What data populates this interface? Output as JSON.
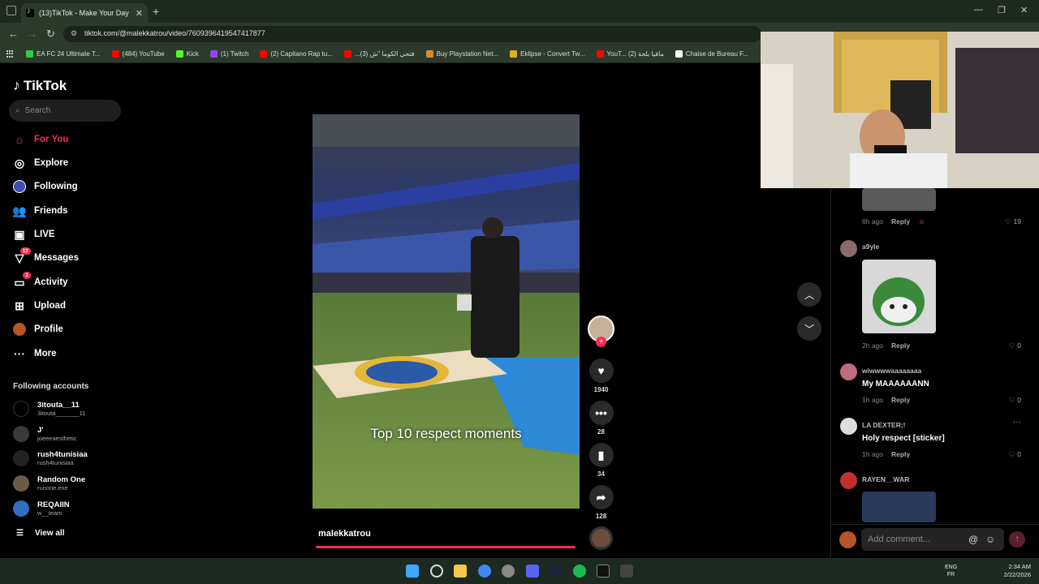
{
  "browser": {
    "tab_title": "(13)TikTok - Make Your Day",
    "new_tab": "+",
    "url": "tiktok.com/@malekkatrou/video/7609396419547417877",
    "bookmarks": [
      {
        "label": "EA FC 24 Ultimate T...",
        "color": "#2ecc40"
      },
      {
        "label": "(484) YouTube",
        "color": "#ff0000"
      },
      {
        "label": "Kick",
        "color": "#53fc18"
      },
      {
        "label": "(1) Twitch",
        "color": "#9146ff"
      },
      {
        "label": "(2) Capitano Rap tu...",
        "color": "#ff0000"
      },
      {
        "label": "...(3) فتحي الكوما \"ش",
        "color": "#ff0000"
      },
      {
        "label": "Buy Playstation Net...",
        "color": "#d98c2b"
      },
      {
        "label": "Eklipse - Convert Tw...",
        "color": "#e0b020"
      },
      {
        "label": "YouT... (2) مافيا بلحة",
        "color": "#ff0000"
      },
      {
        "label": "Chaise de Bureau F...",
        "color": "#ffffff"
      }
    ]
  },
  "sidebar": {
    "logo": "TikTok",
    "search_placeholder": "Search",
    "nav": [
      {
        "label": "For You",
        "icon": "home-icon",
        "active": true
      },
      {
        "label": "Explore",
        "icon": "compass-icon"
      },
      {
        "label": "Following",
        "icon": "following-avatar-icon"
      },
      {
        "label": "Friends",
        "icon": "friends-icon"
      },
      {
        "label": "LIVE",
        "icon": "live-icon"
      },
      {
        "label": "Messages",
        "icon": "messages-icon",
        "badge": "12"
      },
      {
        "label": "Activity",
        "icon": "activity-icon",
        "badge": "1"
      },
      {
        "label": "Upload",
        "icon": "upload-icon"
      },
      {
        "label": "Profile",
        "icon": "profile-icon"
      },
      {
        "label": "More",
        "icon": "more-icon"
      }
    ],
    "following_title": "Following accounts",
    "accounts": [
      {
        "name": "3itouta__11",
        "handle": "3itouta_______11"
      },
      {
        "name": "J'",
        "handle": "joeeeaesthetic"
      },
      {
        "name": "rush4tunisiaa",
        "handle": "rush4tunisiaa"
      },
      {
        "name": "Random One",
        "handle": "runone.exe"
      },
      {
        "name": "REQAIIN",
        "handle": "w__team"
      }
    ],
    "view_all": "View all"
  },
  "video": {
    "caption": "Top 10 respect moments",
    "author": "malekkatrou",
    "likes": "1940",
    "comments": "28",
    "saves": "34",
    "shares": "128"
  },
  "comments": [
    {
      "user": "",
      "meta": "6h ago",
      "reply": "Reply",
      "likes": "19"
    },
    {
      "user": "a9yle",
      "meta": "2h ago",
      "reply": "Reply",
      "likes": "0"
    },
    {
      "user": "wiwwwwaaaaaaaa",
      "text": "My MAAAAAANN",
      "meta": "1h ago",
      "reply": "Reply",
      "likes": "0"
    },
    {
      "user": "LA DEXTER;!",
      "text": "Holy respect [sticker]",
      "meta": "1h ago",
      "reply": "Reply",
      "likes": "0"
    },
    {
      "user": "RAYEN__WAR"
    }
  ],
  "add_comment_placeholder": "Add comment...",
  "taskbar": {
    "lang_top": "ENG",
    "lang_bottom": "FR",
    "time": "2:34 AM",
    "date": "2/22/2026"
  }
}
